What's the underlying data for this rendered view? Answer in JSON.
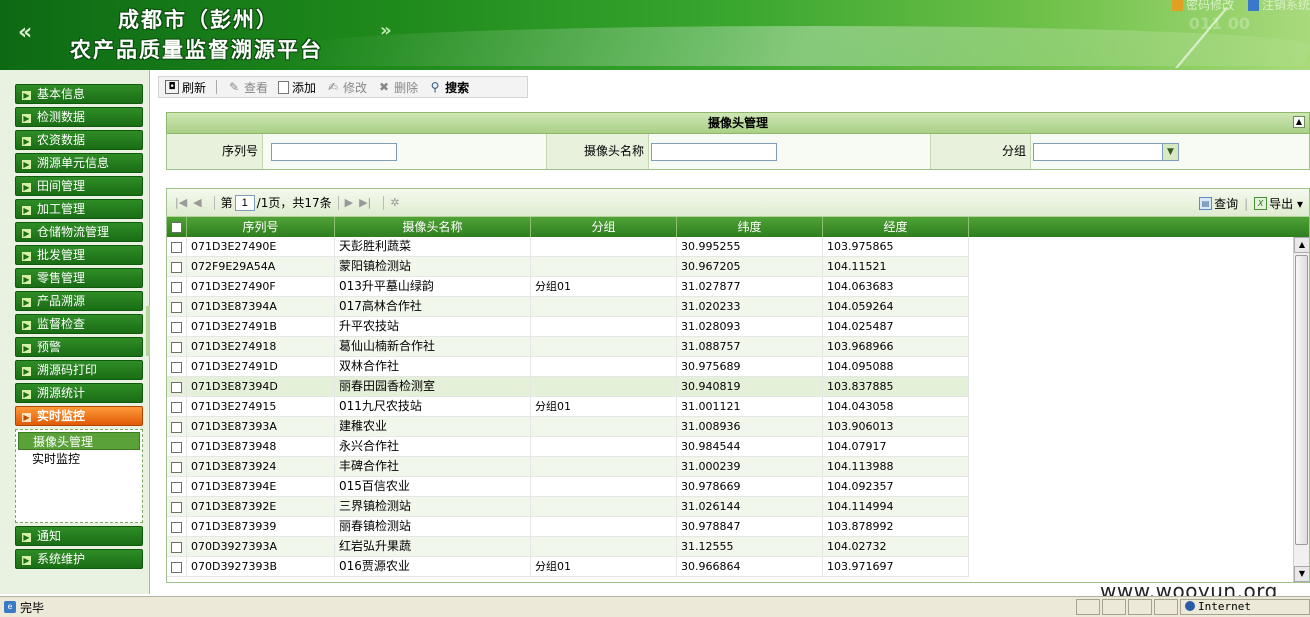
{
  "header": {
    "title_line1": "成都市（彭州）",
    "title_line2": "农产品质量监督溯源平台",
    "left_arrows": "«",
    "right_arrows": "»",
    "top_links": [
      "密码修改",
      "注销系统"
    ]
  },
  "sidebar": {
    "items": [
      {
        "label": "基本信息"
      },
      {
        "label": "检测数据"
      },
      {
        "label": "农资数据"
      },
      {
        "label": "溯源单元信息"
      },
      {
        "label": "田间管理"
      },
      {
        "label": "加工管理"
      },
      {
        "label": "仓储物流管理"
      },
      {
        "label": "批发管理"
      },
      {
        "label": "零售管理"
      },
      {
        "label": "产品溯源"
      },
      {
        "label": "监督检查"
      },
      {
        "label": "预警"
      },
      {
        "label": "溯源码打印"
      },
      {
        "label": "溯源统计"
      },
      {
        "label": "实时监控"
      }
    ],
    "submenu": [
      "摄像头管理",
      "实时监控"
    ],
    "bottom_items": [
      {
        "label": "通知"
      },
      {
        "label": "系统维护"
      }
    ]
  },
  "toolbar": {
    "refresh": "刷新",
    "view": "查看",
    "add": "添加",
    "edit": "修改",
    "delete": "删除",
    "search": "搜索"
  },
  "filter": {
    "title": "摄像头管理",
    "serial_label": "序列号",
    "name_label": "摄像头名称",
    "group_label": "分组",
    "serial_value": "",
    "name_value": "",
    "group_value": ""
  },
  "pager": {
    "page_prefix": "第",
    "page_value": "1",
    "page_suffix": "/1页，共17条",
    "query": "查询",
    "export": "导出"
  },
  "grid": {
    "columns": [
      "序列号",
      "摄像头名称",
      "分组",
      "纬度",
      "经度"
    ],
    "rows": [
      [
        "071D3E27490E",
        "天彭胜利蔬菜",
        "",
        "30.995255",
        "103.975865"
      ],
      [
        "072F9E29A54A",
        "蒙阳镇检测站",
        "",
        "30.967205",
        "104.11521"
      ],
      [
        "071D3E27490F",
        "013升平墓山绿韵",
        "分组01",
        "31.027877",
        "104.063683"
      ],
      [
        "071D3E87394A",
        "017高林合作社",
        "",
        "31.020233",
        "104.059264"
      ],
      [
        "071D3E27491B",
        "升平农技站",
        "",
        "31.028093",
        "104.025487"
      ],
      [
        "071D3E274918",
        "葛仙山楠新合作社",
        "",
        "31.088757",
        "103.968966"
      ],
      [
        "071D3E27491D",
        "双林合作社",
        "",
        "30.975689",
        "104.095088"
      ],
      [
        "071D3E87394D",
        "丽春田园香检测室",
        "",
        "30.940819",
        "103.837885"
      ],
      [
        "071D3E274915",
        "011九尺农技站",
        "分组01",
        "31.001121",
        "104.043058"
      ],
      [
        "071D3E87393A",
        "建稚农业",
        "",
        "31.008936",
        "103.906013"
      ],
      [
        "071D3E873948",
        "永兴合作社",
        "",
        "30.984544",
        "104.07917"
      ],
      [
        "071D3E873924",
        "丰碑合作社",
        "",
        "31.000239",
        "104.113988"
      ],
      [
        "071D3E87394E",
        "015百信农业",
        "",
        "30.978669",
        "104.092357"
      ],
      [
        "071D3E87392E",
        "三界镇检测站",
        "",
        "31.026144",
        "104.114994"
      ],
      [
        "071D3E873939",
        "丽春镇检测站",
        "",
        "30.978847",
        "103.878992"
      ],
      [
        "070D3927393A",
        "红岩弘升果蔬",
        "",
        "31.12555",
        "104.02732"
      ],
      [
        "070D3927393B",
        "016贾源农业",
        "分组01",
        "30.966864",
        "103.971697"
      ]
    ]
  },
  "watermark": "www.wooyun.org",
  "status": {
    "done": "完毕",
    "zone": "Internet"
  },
  "colors": {
    "nav_green": "#1a6d15",
    "active_orange": "#e05a06",
    "grid_header": "#2f7d1f"
  }
}
